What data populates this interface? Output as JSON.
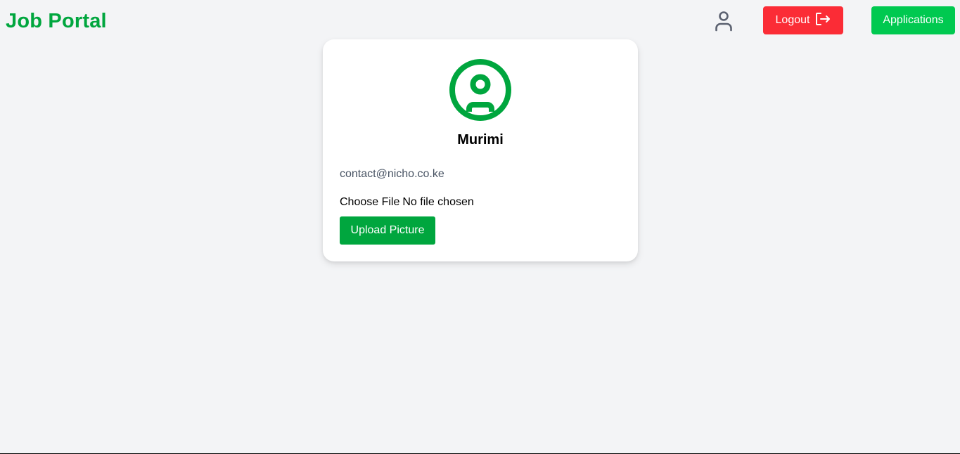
{
  "header": {
    "brand": "Job Portal",
    "user_icon": "user-icon",
    "logout_label": "Logout",
    "logout_icon": "logout-icon",
    "applications_label": "Applications"
  },
  "profile": {
    "avatar_icon": "user-circle-icon",
    "name": "Murimi",
    "email": "contact@nicho.co.ke",
    "file_button_label": "Choose File",
    "file_status": "No file chosen",
    "upload_label": "Upload Picture"
  },
  "colors": {
    "brand": "#00a63e",
    "logout": "#fb2c36",
    "applications": "#00c950",
    "upload": "#00a63e",
    "background": "#f3f4f6"
  }
}
